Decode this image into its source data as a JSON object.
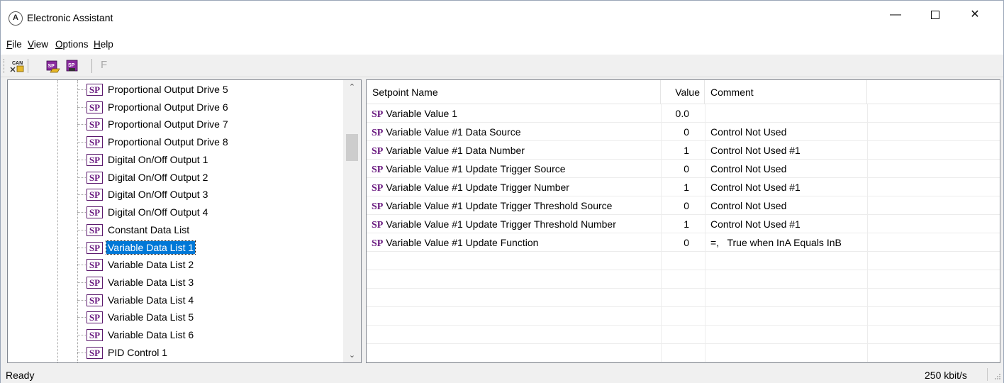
{
  "window": {
    "title": "Electronic Assistant",
    "minimize": "—",
    "close": "✕"
  },
  "menu": [
    {
      "label": "File",
      "accel": "F",
      "rest": "ile"
    },
    {
      "label": "View",
      "accel": "V",
      "rest": "iew"
    },
    {
      "label": "Options",
      "accel": "O",
      "rest": "ptions"
    },
    {
      "label": "Help",
      "accel": "H",
      "rest": "elp"
    }
  ],
  "toolbar": {
    "can_icon": "CAN",
    "sp_icon": "SP",
    "f_label": "F"
  },
  "tree": {
    "icon_text": "SP",
    "items": [
      {
        "label": "Proportional Output Drive 5"
      },
      {
        "label": "Proportional Output Drive 6"
      },
      {
        "label": "Proportional Output Drive 7"
      },
      {
        "label": "Proportional Output Drive 8"
      },
      {
        "label": "Digital On/Off Output 1"
      },
      {
        "label": "Digital On/Off Output 2"
      },
      {
        "label": "Digital On/Off Output 3"
      },
      {
        "label": "Digital On/Off Output 4"
      },
      {
        "label": "Constant Data List"
      },
      {
        "label": "Variable Data List 1"
      },
      {
        "label": "Variable Data List 2"
      },
      {
        "label": "Variable Data List 3"
      },
      {
        "label": "Variable Data List 4"
      },
      {
        "label": "Variable Data List 5"
      },
      {
        "label": "Variable Data List 6"
      },
      {
        "label": "PID Control 1"
      }
    ],
    "selected_index": 9
  },
  "setpoints": {
    "columns": {
      "name": "Setpoint Name",
      "value": "Value",
      "comment": "Comment"
    },
    "sp_label": "SP",
    "rows": [
      {
        "name": "Variable Value 1",
        "value": "0.0",
        "comment": ""
      },
      {
        "name": "Variable Value #1 Data Source",
        "value": "0",
        "comment": "Control Not Used"
      },
      {
        "name": "Variable Value #1 Data Number",
        "value": "1",
        "comment": "Control Not Used #1"
      },
      {
        "name": "Variable Value #1 Update Trigger Source",
        "value": "0",
        "comment": "Control Not Used"
      },
      {
        "name": "Variable Value #1 Update Trigger Number",
        "value": "1",
        "comment": "Control Not Used #1"
      },
      {
        "name": "Variable Value #1 Update Trigger Threshold Source",
        "value": "0",
        "comment": "Control Not Used"
      },
      {
        "name": "Variable Value #1 Update Trigger Threshold Number",
        "value": "1",
        "comment": "Control Not Used #1"
      },
      {
        "name": "Variable Value #1 Update Function",
        "value": "0",
        "comment": "=,   True when InA Equals InB"
      }
    ]
  },
  "status": {
    "text": "Ready",
    "bitrate": "250 kbit/s"
  }
}
